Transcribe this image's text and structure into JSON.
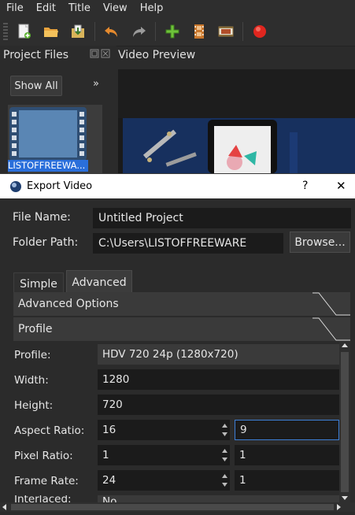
{
  "menu": [
    "File",
    "Edit",
    "Title",
    "View",
    "Help"
  ],
  "toolbar": {
    "icons": [
      "new-project-icon",
      "open-project-icon",
      "save-project-icon",
      "undo-icon",
      "redo-icon",
      "import-files-icon",
      "profile-icon",
      "fullscreen-icon",
      "export-video-icon"
    ]
  },
  "project_files": {
    "title": "Project Files",
    "show_all": "Show All",
    "more": "»",
    "thumb_label": "LISTOFFREEWA..."
  },
  "video_preview": {
    "title": "Video Preview"
  },
  "dialog": {
    "title": "Export Video",
    "help": "?",
    "close": "✕",
    "file_name_label": "File Name:",
    "file_name_value": "Untitled Project",
    "folder_path_label": "Folder Path:",
    "folder_path_value": "C:\\Users\\LISTOFFREEWARE",
    "browse": "Browse...",
    "tabs": [
      "Simple",
      "Advanced"
    ],
    "sections": {
      "advanced_options": "Advanced Options",
      "profile": "Profile"
    },
    "profile_label": "Profile:",
    "profile_value": "HDV 720 24p (1280x720)",
    "width_label": "Width:",
    "width_value": "1280",
    "height_label": "Height:",
    "height_value": "720",
    "aspect_label": "Aspect Ratio:",
    "aspect_num": "16",
    "aspect_den": "9",
    "pixel_label": "Pixel Ratio:",
    "pixel_num": "1",
    "pixel_den": "1",
    "frame_label": "Frame Rate:",
    "frame_num": "24",
    "frame_den": "1",
    "interlaced_label": "Interlaced:",
    "interlaced_value": "No"
  },
  "colors": {
    "accent_blue": "#2a6fdb",
    "focus_border": "#3d7fd6"
  }
}
